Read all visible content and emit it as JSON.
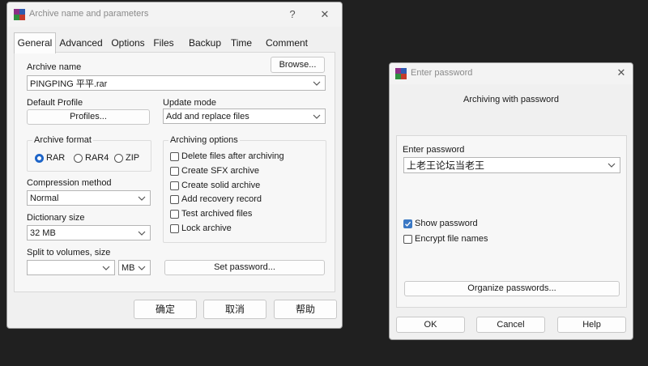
{
  "archive_dialog": {
    "title": "Archive name and parameters",
    "help_glyph": "?",
    "close_glyph": "✕",
    "tabs": [
      "General",
      "Advanced",
      "Options",
      "Files",
      "Backup",
      "Time",
      "Comment"
    ],
    "archive_name_label": "Archive name",
    "browse_label": "Browse...",
    "archive_name_value": "PINGPING 平平.rar",
    "default_profile_label": "Default Profile",
    "profiles_label": "Profiles...",
    "update_mode_label": "Update mode",
    "update_mode_value": "Add and replace files",
    "archive_format_label": "Archive format",
    "formats": [
      {
        "label": "RAR",
        "selected": true
      },
      {
        "label": "RAR4",
        "selected": false
      },
      {
        "label": "ZIP",
        "selected": false
      }
    ],
    "archiving_options_label": "Archiving options",
    "options": [
      {
        "label": "Delete files after archiving",
        "checked": false
      },
      {
        "label": "Create SFX archive",
        "checked": false
      },
      {
        "label": "Create solid archive",
        "checked": false
      },
      {
        "label": "Add recovery record",
        "checked": false
      },
      {
        "label": "Test archived files",
        "checked": false
      },
      {
        "label": "Lock archive",
        "checked": false
      }
    ],
    "compression_method_label": "Compression method",
    "compression_method_value": "Normal",
    "dictionary_size_label": "Dictionary size",
    "dictionary_size_value": "32 MB",
    "split_label": "Split to volumes, size",
    "split_value": "",
    "split_unit_value": "MB",
    "set_password_label": "Set password...",
    "ok_label": "确定",
    "cancel_label": "取消",
    "help_label": "帮助"
  },
  "password_dialog": {
    "title": "Enter password",
    "close_glyph": "✕",
    "subtitle": "Archiving with password",
    "enter_password_label": "Enter password",
    "password_value": "上老王论坛当老王",
    "show_password_label": "Show password",
    "show_password_checked": true,
    "encrypt_names_label": "Encrypt file names",
    "encrypt_names_checked": false,
    "organize_label": "Organize passwords...",
    "ok_label": "OK",
    "cancel_label": "Cancel",
    "help_label": "Help"
  },
  "colors": {
    "desktop": "#202020",
    "dialog_bg": "#f0f0f0",
    "accent": "#1e65c8",
    "title_text": "#8a8a8a"
  },
  "icons": [
    "winrar-icon",
    "help-icon",
    "close-icon",
    "chevron-down-icon",
    "checkmark-icon"
  ]
}
